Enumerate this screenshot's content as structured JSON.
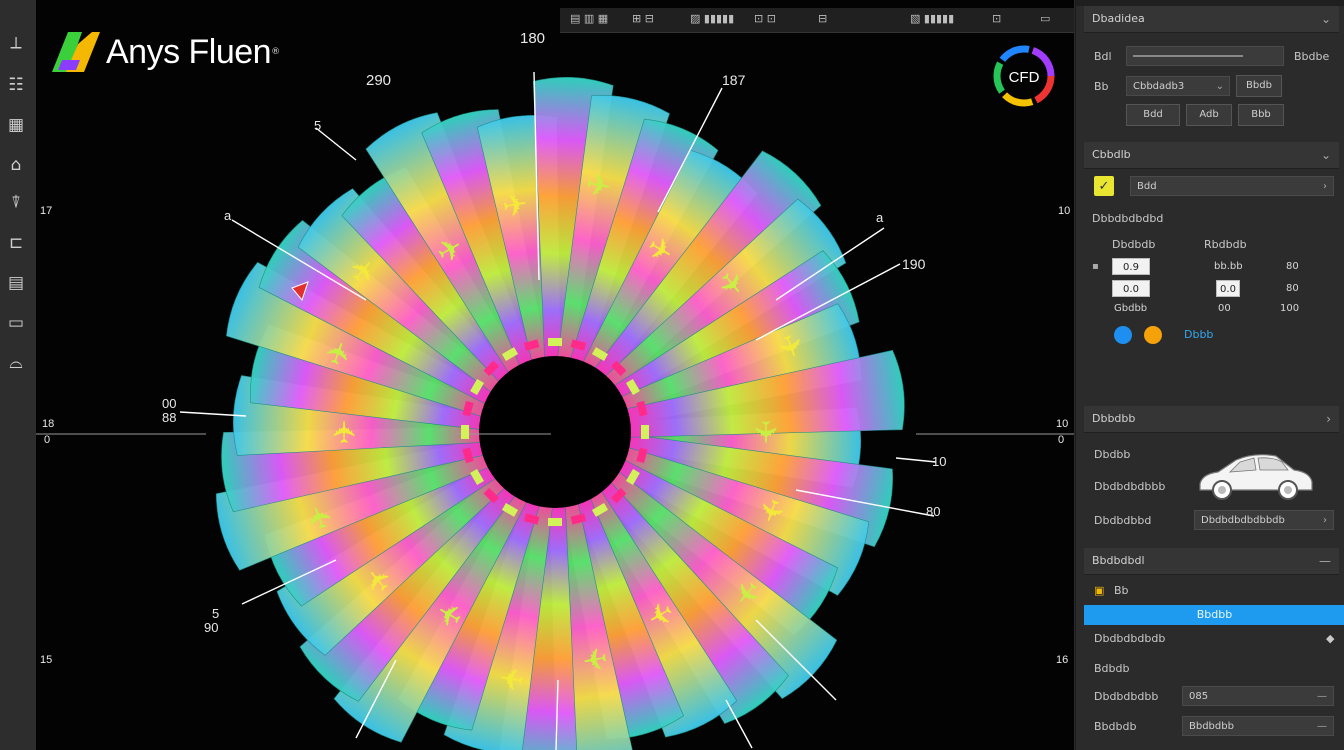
{
  "app": {
    "logo_text": "Anys Fluen",
    "logo_mark": "®",
    "badge": "CFD"
  },
  "toolbar": {
    "items": [
      "▤ ▥ ▦",
      "⊞ ⊟",
      "▨ ▮▮▮▮▮",
      "⊡ ⊡",
      "⊟",
      "▧ ▮▮▮▮▮",
      "⊡",
      "▭"
    ]
  },
  "left_toolbar": {
    "icons": [
      "ruler-icon",
      "tree-icon",
      "mesh-icon",
      "geometry-icon",
      "probe-icon",
      "folder-icon",
      "report-icon",
      "frame-icon",
      "camera-icon"
    ]
  },
  "viewport": {
    "labels": {
      "top_center": "180",
      "top_left": "290",
      "top_right": "187",
      "upper_left_small": "5",
      "left_upper": "a",
      "right_upper": "a",
      "right_mid_upper": "190",
      "left_mid": "00",
      "left_mid2": "88",
      "right_mid": "10",
      "right_mid_lower": "80",
      "left_lower": "5",
      "left_lower2": "90",
      "edge_left_top": "17",
      "edge_right_top": "10",
      "edge_left_mid": "18",
      "edge_left_mid2": "0",
      "edge_right_mid": "10",
      "edge_right_mid2": "0",
      "edge_left_bottom": "15",
      "edge_right_bottom": "16"
    }
  },
  "panel": {
    "header1": "Dbadidea",
    "row1_label": "Bdl",
    "row1_button": "Bbdbe",
    "row2_label": "Bb",
    "row2_select": "Cbbdadb3",
    "row2_button": "Bbdb",
    "row3_buttons": [
      "Bdd",
      "Adb",
      "Bbb"
    ],
    "header2": "Cbbdlb",
    "select2": "Bdd",
    "subhead": "Dbbdbdbdbd",
    "table_headers": [
      "Dbdbdb",
      "Rbdbdb"
    ],
    "table_rows": [
      [
        "0.9",
        "bb.bb",
        "80"
      ],
      [
        "0.0",
        "0.0",
        "80"
      ],
      [
        "Gbdbb",
        "00",
        "100"
      ]
    ],
    "icon_row_label": "Dbbb",
    "header3": "Dbbdbb",
    "car_label": "Dbdbb",
    "car_label2": "Dbdbdbdbbb",
    "car_label3": "Dbdbdbbd",
    "car_select": "Dbdbdbdbdbbdb",
    "header4": "Bbdbdbdl",
    "bb_label": "Bb",
    "blue_button": "Bbdbb",
    "sub4": "Dbdbdbdbdb",
    "sub5": "Bdbdb",
    "field_a_label": "Dbdbdbdbb",
    "field_a_value": "085",
    "field_b_label": "Bbdbdb",
    "field_b_value": "Bbdbdbb"
  },
  "colors": {
    "accent": "#1e9bef",
    "viewport_bg": "#030303",
    "panel_bg": "#2b2b2b"
  }
}
